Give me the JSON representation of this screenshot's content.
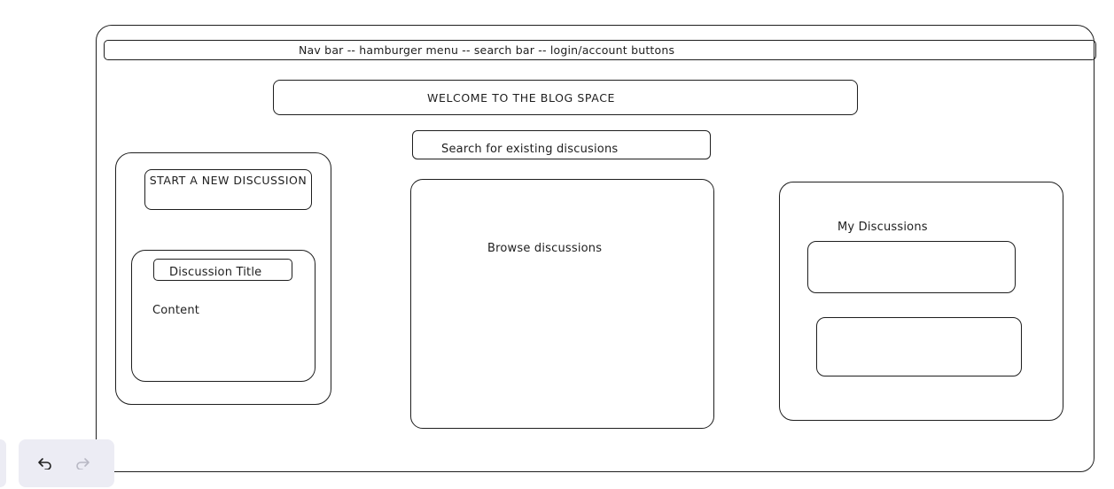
{
  "navbar": {
    "text": "Nav bar -- hamburger menu -- search bar -- login/account buttons"
  },
  "welcome": {
    "title": "WELCOME TO THE BLOG SPACE"
  },
  "search": {
    "text": "Search for existing discusions"
  },
  "left_panel": {
    "new_discussion_label": "START A NEW DISCUSSION",
    "title_field_text": "Discussion Title",
    "content_text": "Content"
  },
  "browse": {
    "text": "Browse discussions"
  },
  "my_discussions": {
    "title": "My Discussions"
  },
  "toolbar": {
    "undo_icon": "undo-icon",
    "redo_icon": "redo-icon"
  },
  "colors": {
    "stroke": "#1e1e1e",
    "toolbar_bg": "#ececf4",
    "disabled_icon": "#b8b8c4"
  }
}
